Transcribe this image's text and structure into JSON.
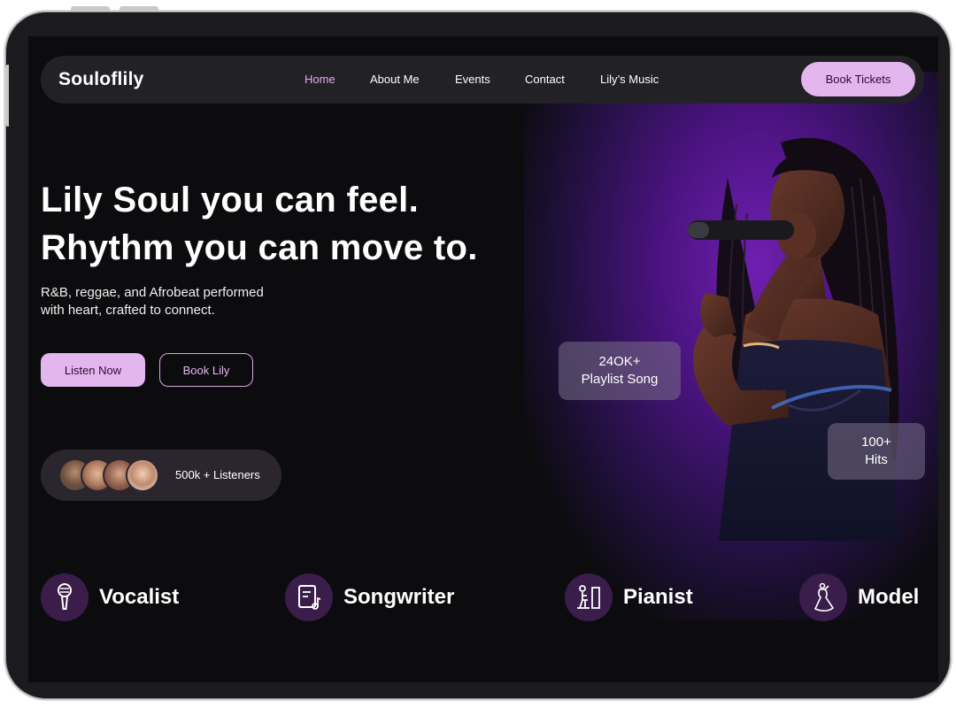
{
  "nav": {
    "logo": "Souloflily",
    "links": [
      {
        "label": "Home",
        "active": true
      },
      {
        "label": "About Me",
        "active": false
      },
      {
        "label": "Events",
        "active": false
      },
      {
        "label": "Contact",
        "active": false
      },
      {
        "label": "Lily’s Music",
        "active": false
      }
    ],
    "cta_label": "Book Tickets"
  },
  "hero": {
    "title_line1": "Lily Soul you can feel.",
    "title_line2": "Rhythm you can move to.",
    "subtitle_line1": "R&B, reggae, and Afrobeat performed",
    "subtitle_line2": "with heart, crafted to connect.",
    "primary_button": "Listen Now",
    "secondary_button": "Book Lily"
  },
  "listeners": {
    "label": "500k + Listeners"
  },
  "stats": [
    {
      "value": "24OK+",
      "caption": "Playlist Song"
    },
    {
      "value": "100+",
      "caption": "Hits"
    }
  ],
  "roles": [
    {
      "label": "Vocalist",
      "icon": "microphone-icon"
    },
    {
      "label": "Songwriter",
      "icon": "music-sheet-icon"
    },
    {
      "label": "Pianist",
      "icon": "piano-player-icon"
    },
    {
      "label": "Model",
      "icon": "dress-icon"
    }
  ],
  "colors": {
    "accent": "#e4b6ee",
    "active_nav": "#e4a9ec",
    "background": "#0c0c0f",
    "glow": "#6f1fb0"
  }
}
